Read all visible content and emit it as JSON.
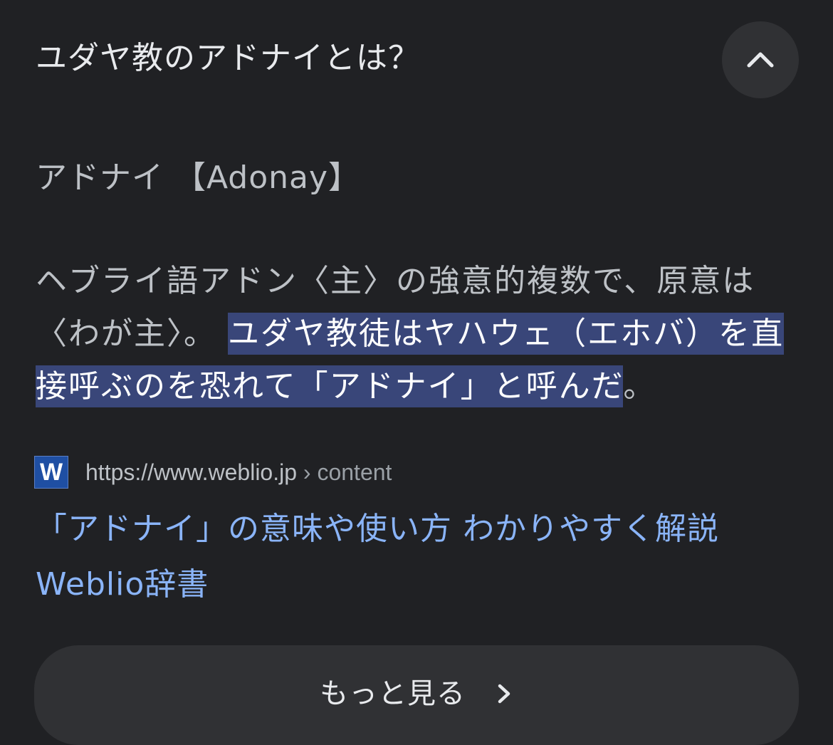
{
  "question": {
    "text": "ユダヤ教のアドナイとは？",
    "collapse_icon": "chevron-up-icon"
  },
  "answer": {
    "term": "アドナイ 【Adonay】",
    "definition_plain": "ヘブライ語アドン〈主〉の強意的複数で、原意は〈わが主〉。",
    "definition_highlight": "ユダヤ教徒はヤハウェ（エホバ）を直接呼ぶのを恐れて「アドナイ」と呼んだ",
    "definition_end": "。"
  },
  "source": {
    "favicon_letter": "W",
    "url_domain": "https://www.weblio.jp",
    "url_path": " › content",
    "title": "「アドナイ」の意味や使い方 わかりやすく解説 Weblio辞書"
  },
  "more": {
    "label": "もっと見る",
    "icon": "chevron-right-icon"
  },
  "colors": {
    "background": "#202124",
    "highlight": "#394679",
    "link": "#8ab4f8",
    "button_bg": "#303134"
  }
}
